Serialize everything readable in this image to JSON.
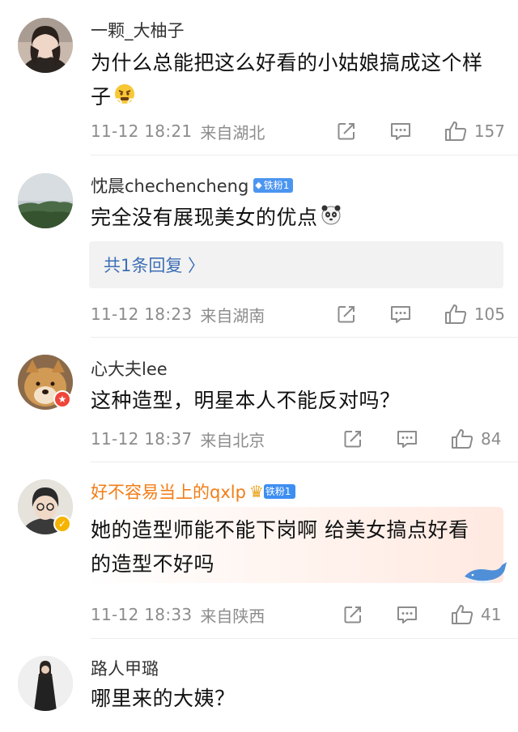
{
  "comments": [
    {
      "username": "一颗_大柚子",
      "text_lines": [
        "为什么总能把这么好看的小姑娘搞成这个样",
        "子"
      ],
      "time": "11-12 18:21",
      "location": "来自湖北",
      "likes": "157"
    },
    {
      "username": "忱晨chechencheng",
      "badge": "铁粉1",
      "text_lines": [
        "完全没有展现美女的优点"
      ],
      "reply_link": "共1条回复 〉",
      "time": "11-12 18:23",
      "location": "来自湖南",
      "likes": "105"
    },
    {
      "username": "心大夫lee",
      "text_lines": [
        "这种造型，明星本人不能反对吗？"
      ],
      "time": "11-12 18:37",
      "location": "来自北京",
      "likes": "84"
    },
    {
      "username": "好不容易当上的qxlp",
      "badge": "铁粉1",
      "text_lines": [
        "她的造型师能不能下岗啊 给美女搞点好看",
        "的造型不好吗"
      ],
      "time": "11-12 18:33",
      "location": "来自陕西",
      "likes": "41"
    },
    {
      "username": "路人甲璐",
      "text_lines": [
        "哪里来的大姨？"
      ]
    }
  ],
  "colors": {
    "meta_gray": "#8c8c8c",
    "vip_orange": "#f27d16",
    "link_blue": "#3d6fb5",
    "badge_blue": "#4b95f0"
  },
  "icons": [
    "repost-icon",
    "comment-icon",
    "like-icon"
  ]
}
